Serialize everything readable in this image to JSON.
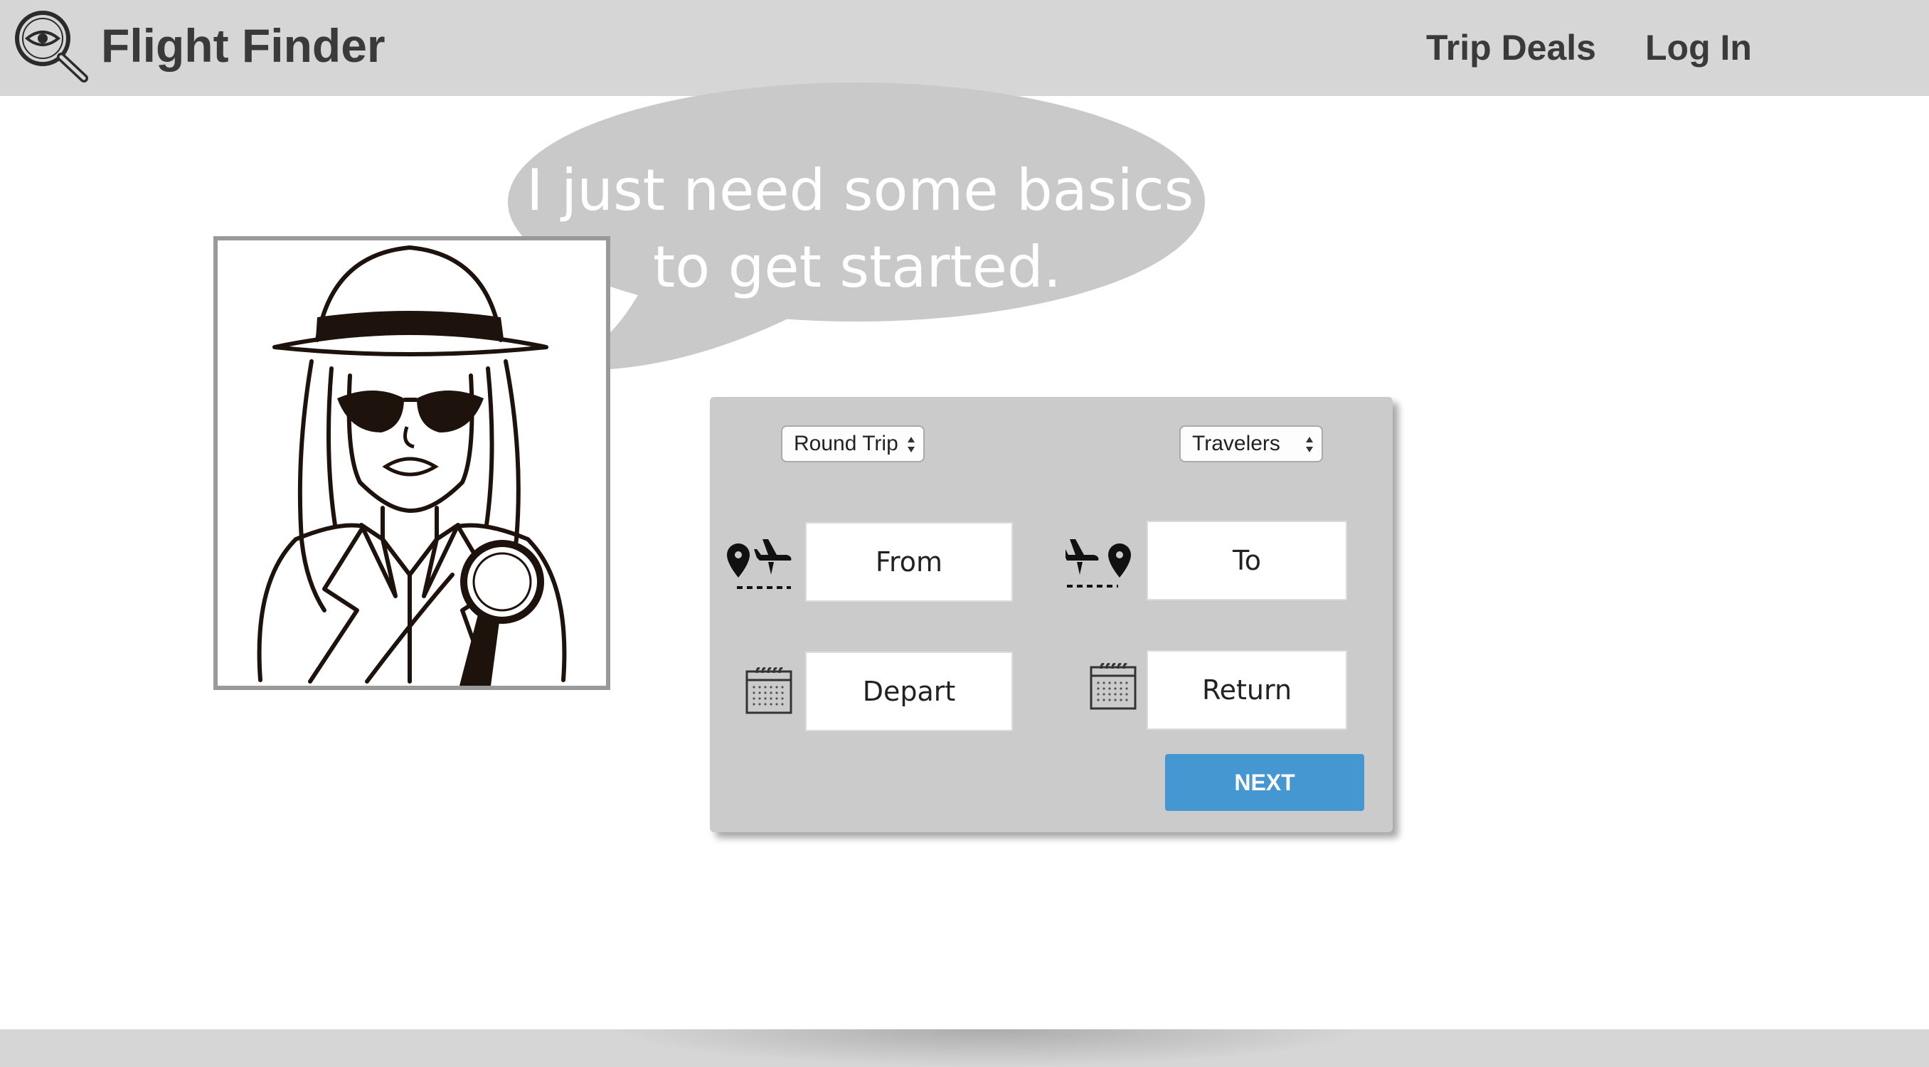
{
  "header": {
    "brand": "Flight Finder",
    "logo_icon": "magnifier-eye-icon",
    "nav": {
      "trip_deals": "Trip Deals",
      "log_in": "Log In"
    }
  },
  "hero": {
    "illustration": "detective-woman",
    "speech": {
      "line1": "I just need some basics",
      "line2": "to get started."
    }
  },
  "search": {
    "trip_type": "Round Trip",
    "travelers": "Travelers",
    "from_placeholder": "From",
    "to_placeholder": "To",
    "depart_placeholder": "Depart",
    "return_placeholder": "Return",
    "next_label": "NEXT",
    "icons": {
      "from": "departure-plane-pin-icon",
      "to": "arrival-plane-pin-icon",
      "depart": "calendar-icon",
      "return": "calendar-icon"
    }
  },
  "colors": {
    "header_bg": "#d6d6d6",
    "panel_bg": "#cbcbcb",
    "bubble_bg": "#c9c9c9",
    "accent": "#4597d2"
  }
}
